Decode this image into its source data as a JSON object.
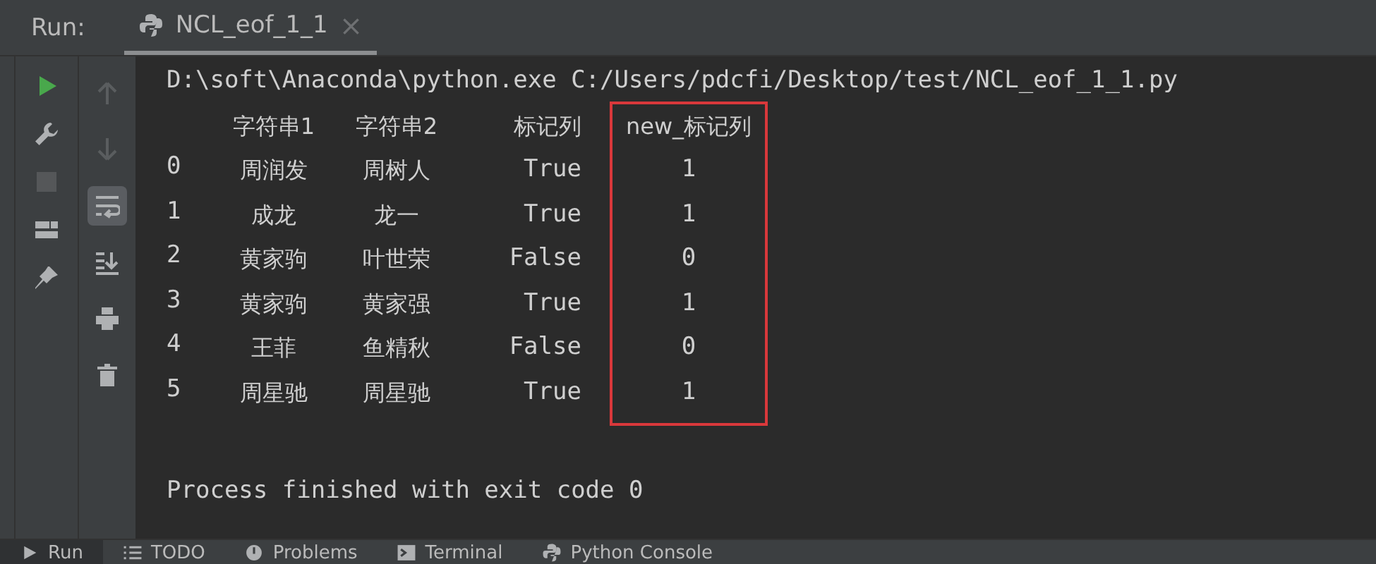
{
  "run_bar": {
    "label": "Run:",
    "tab": {
      "title": "NCL_eof_1_1",
      "close": "×",
      "selected": true
    }
  },
  "toolbar_left": [
    {
      "kind": "run",
      "disabled": false
    },
    {
      "kind": "wrench",
      "disabled": false
    },
    {
      "kind": "stop",
      "disabled": true
    },
    {
      "kind": "layout",
      "disabled": false
    },
    {
      "kind": "pin",
      "disabled": false
    }
  ],
  "toolbar_right": [
    {
      "kind": "up",
      "selected": false
    },
    {
      "kind": "down",
      "selected": false
    },
    {
      "kind": "wrap",
      "selected": true
    },
    {
      "kind": "scroll-end",
      "selected": false
    },
    {
      "kind": "print",
      "selected": false
    },
    {
      "kind": "trash",
      "selected": false
    }
  ],
  "console": {
    "command": "D:\\soft\\Anaconda\\python.exe C:/Users/pdcfi/Desktop/test/NCL_eof_1_1.py",
    "columns": [
      {
        "header": "字符串1",
        "highlighted": false
      },
      {
        "header": "字符串2",
        "highlighted": false
      },
      {
        "header": "标记列",
        "highlighted": false
      },
      {
        "header": "new_标记列",
        "highlighted": true
      }
    ],
    "rows": [
      {
        "index": "0",
        "cells": [
          "周润发",
          "周树人",
          "True",
          "1"
        ]
      },
      {
        "index": "1",
        "cells": [
          "成龙",
          "龙一",
          "True",
          "1"
        ]
      },
      {
        "index": "2",
        "cells": [
          "黄家驹",
          "叶世荣",
          "False",
          "0"
        ]
      },
      {
        "index": "3",
        "cells": [
          "黄家驹",
          "黄家强",
          "True",
          "1"
        ]
      },
      {
        "index": "4",
        "cells": [
          "王菲",
          "鱼精秋",
          "False",
          "0"
        ]
      },
      {
        "index": "5",
        "cells": [
          "周星驰",
          "周星驰",
          "True",
          "1"
        ]
      }
    ],
    "exit_message": "Process finished with exit code 0"
  },
  "bottom_tabs": [
    {
      "kind": "run",
      "label": "Run",
      "selected": true
    },
    {
      "kind": "todo",
      "label": "TODO",
      "selected": false
    },
    {
      "kind": "problems",
      "label": "Problems",
      "selected": false
    },
    {
      "kind": "terminal",
      "label": "Terminal",
      "selected": false
    },
    {
      "kind": "python",
      "label": "Python Console",
      "selected": false
    }
  ]
}
